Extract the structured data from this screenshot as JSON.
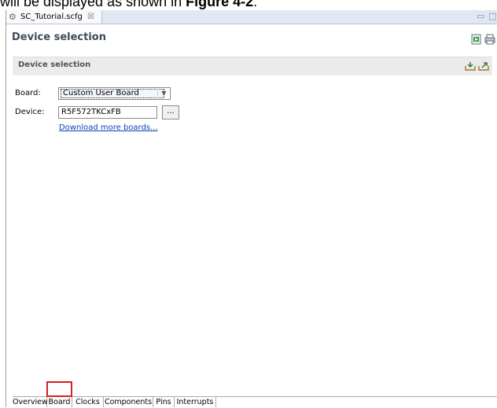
{
  "caption": {
    "text": "will be displayed as shown in ",
    "figure": "Figure 4-2",
    "end": "."
  },
  "editor_tab": {
    "title": "SC_Tutorial.scfg",
    "close_glyph": "☒"
  },
  "window_controls": {
    "minimize": "▭",
    "maximize": "□"
  },
  "editor_title": "Device selection",
  "section": {
    "title": "Device selection"
  },
  "form": {
    "board_label": "Board:",
    "board_value": "Custom User Board",
    "device_label": "Device:",
    "device_value": "R5F572TKCxFB",
    "browse_label": "...",
    "download_link": "Download more boards..."
  },
  "bottom_tabs": [
    "Overview",
    "Board",
    "Clocks",
    "Components",
    "Pins",
    "Interrupts"
  ],
  "colors": {
    "highlight": "#d42020",
    "link": "#0b3fb2",
    "title": "#3c4a5a"
  },
  "icons": [
    "gear-icon",
    "close-icon",
    "generate-code-icon",
    "print-icon",
    "import-icon",
    "export-icon",
    "chevron-down-icon"
  ]
}
